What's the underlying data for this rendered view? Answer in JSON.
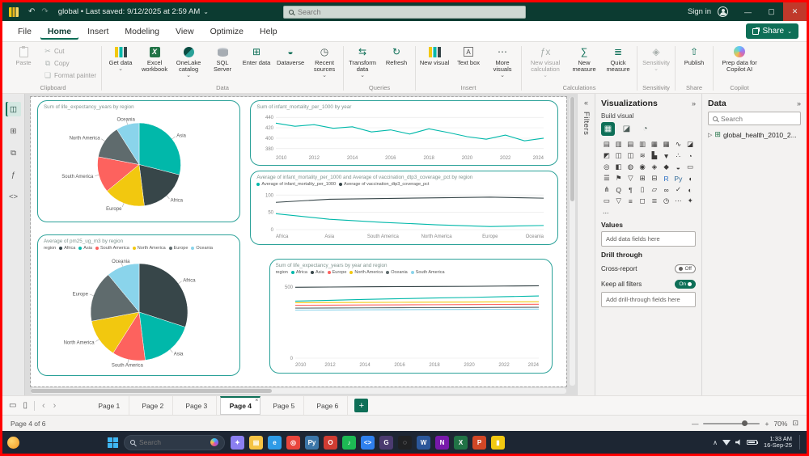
{
  "colors": {
    "titlebar_bg": "#0C3B31",
    "accent_green": "#0E6F57",
    "visual_border": "#2AA198",
    "palette": [
      "#01B8AA",
      "#374649",
      "#FD625E",
      "#F2C80F",
      "#5F6B6D",
      "#8AD4EB"
    ],
    "taskbar_bg": "#1D2633",
    "frame_border": "#FF0000"
  },
  "glyphs": {
    "caret": "⌄",
    "undo": "↶",
    "redo": "↷",
    "minimize": "—",
    "maximize": "▢",
    "close": "✕",
    "chev_left": "«",
    "chev_right": "»",
    "expander": "▷",
    "close_tab": "×",
    "plus": "+",
    "minus": "—",
    "fit": "⊡",
    "arrow_left": "‹",
    "arrow_right": "›",
    "monitor": "▭",
    "phone": "▯",
    "cut": "✂",
    "copy": "⧉",
    "format_painter": "❏",
    "excel_x": "X",
    "enter_data": "⊞",
    "dataverse": "◒",
    "recent": "◷",
    "transform": "⇆",
    "refresh": "↻",
    "text_box": "A",
    "more_dots": "⋯",
    "fx": "ƒx",
    "sum": "∑",
    "quick": "≣",
    "sensitivity": "◈",
    "publish": "⇧",
    "build_tab": "▦",
    "format_tab": "◪",
    "analytics_tab": "◔",
    "table_green": "⊞",
    "tray_chevron": "∧"
  },
  "titlebar": {
    "title_full": "global  •  Last saved: 9/12/2025 at 2:59 AM",
    "search_placeholder": "Search",
    "sign_in": "Sign in"
  },
  "menubar": {
    "items": [
      "File",
      "Home",
      "Insert",
      "Modeling",
      "View",
      "Optimize",
      "Help"
    ],
    "share": "Share"
  },
  "ribbon": {
    "clipboard": {
      "label": "Clipboard",
      "paste": "Paste",
      "cut": "Cut",
      "copy": "Copy",
      "format_painter": "Format painter"
    },
    "data_group": {
      "label": "Data",
      "get_data": "Get data",
      "excel": "Excel workbook",
      "onelake": "OneLake catalog",
      "sql": "SQL Server",
      "enter": "Enter data",
      "dataverse": "Dataverse",
      "recent": "Recent sources"
    },
    "queries": {
      "label": "Queries",
      "transform": "Transform data",
      "refresh": "Refresh"
    },
    "insert": {
      "label": "Insert",
      "new_visual": "New visual",
      "text_box": "Text box",
      "more_visuals": "More visuals"
    },
    "calculations": {
      "label": "Calculations",
      "new_calc": "New visual calculation",
      "new_measure": "New measure",
      "quick_measure": "Quick measure"
    },
    "sensitivity": {
      "label": "Sensitivity",
      "button": "Sensitivity"
    },
    "share_group": {
      "label": "Share",
      "publish": "Publish"
    },
    "copilot": {
      "label": "Copilot",
      "prep": "Prep data for Copilot AI"
    }
  },
  "view_rail": [
    {
      "name": "report-view",
      "glyph": "◫",
      "selected": true
    },
    {
      "name": "table-view",
      "glyph": "⊞"
    },
    {
      "name": "model-view",
      "glyph": "⧉"
    },
    {
      "name": "dax-query-view",
      "glyph": "ƒ"
    },
    {
      "name": "tmdl-view",
      "glyph": "<>"
    }
  ],
  "filters_panel": {
    "header": "Filters"
  },
  "viz_panel": {
    "header": "Visualizations",
    "build_label": "Build visual",
    "more": "...",
    "values_label": "Values",
    "add_fields": "Add data fields here",
    "drill_label": "Drill through",
    "cross_report": "Cross-report",
    "toggle_off": "Off",
    "keep_filters": "Keep all filters",
    "toggle_on": "On",
    "add_drill": "Add drill-through fields here",
    "gallery": [
      {
        "n": "stacked-bar-chart",
        "g": "▤"
      },
      {
        "n": "stacked-column-chart",
        "g": "▥"
      },
      {
        "n": "clustered-bar-chart",
        "g": "▤"
      },
      {
        "n": "clustered-column-chart",
        "g": "▥"
      },
      {
        "n": "100-stacked-bar-chart",
        "g": "▦"
      },
      {
        "n": "100-stacked-column-chart",
        "g": "▦"
      },
      {
        "n": "line-chart",
        "g": "∿"
      },
      {
        "n": "area-chart",
        "g": "◪"
      },
      {
        "n": "stacked-area-chart",
        "g": "◩"
      },
      {
        "n": "line-and-stacked-column-chart",
        "g": "◫"
      },
      {
        "n": "line-and-clustered-column-chart",
        "g": "◫"
      },
      {
        "n": "ribbon-chart",
        "g": "≋"
      },
      {
        "n": "waterfall-chart",
        "g": "▙"
      },
      {
        "n": "funnel-chart",
        "g": "▼"
      },
      {
        "n": "scatter-chart",
        "g": "∴"
      },
      {
        "n": "pie-chart",
        "g": "◔"
      },
      {
        "n": "donut-chart",
        "g": "◎"
      },
      {
        "n": "treemap",
        "g": "◧"
      },
      {
        "n": "map",
        "g": "◍"
      },
      {
        "n": "filled-map",
        "g": "◉"
      },
      {
        "n": "shape-map",
        "g": "◈"
      },
      {
        "n": "azure-map",
        "g": "◆"
      },
      {
        "n": "gauge",
        "g": "◒"
      },
      {
        "n": "card",
        "g": "▭"
      },
      {
        "n": "multi-row-card",
        "g": "☰"
      },
      {
        "n": "kpi",
        "g": "⚑"
      },
      {
        "n": "slicer",
        "g": "▽"
      },
      {
        "n": "table",
        "g": "⊞"
      },
      {
        "n": "matrix",
        "g": "⊟"
      },
      {
        "n": "r-script-visual",
        "g": "R",
        "c": "#276dc3"
      },
      {
        "n": "python-visual",
        "g": "Py",
        "c": "#306998"
      },
      {
        "n": "key-influencers",
        "g": "◖"
      },
      {
        "n": "decomposition-tree",
        "g": "⋔"
      },
      {
        "n": "q-and-a",
        "g": "Q"
      },
      {
        "n": "smart-narrative",
        "g": "¶"
      },
      {
        "n": "paginated-report",
        "g": "▯"
      },
      {
        "n": "power-apps",
        "g": "▱"
      },
      {
        "n": "power-automate",
        "g": "∞"
      },
      {
        "n": "metrics",
        "g": "✓"
      },
      {
        "n": "arcgis-map",
        "g": "◐"
      },
      {
        "n": "new-card",
        "g": "▭"
      },
      {
        "n": "new-slicer",
        "g": "▽"
      },
      {
        "n": "text-slicer",
        "g": "≡"
      },
      {
        "n": "button-slicer",
        "g": "◻"
      },
      {
        "n": "list-slicer",
        "g": "≣"
      },
      {
        "n": "date-slicer",
        "g": "◷"
      },
      {
        "n": "get-more-visuals",
        "g": "⋯"
      },
      {
        "n": "custom-visual",
        "g": "✦"
      }
    ]
  },
  "data_panel": {
    "header": "Data",
    "search_placeholder": "Search",
    "table": "global_health_2010_2..."
  },
  "pages": {
    "items": [
      "Page 1",
      "Page 2",
      "Page 3",
      "Page 4",
      "Page 5",
      "Page 6"
    ],
    "active": "Page 4"
  },
  "status": {
    "page_info": "Page 4 of 6",
    "zoom": "70%"
  },
  "taskbar": {
    "search_placeholder": "Search",
    "time": "1:33 AM",
    "date": "16-Sep-25",
    "apps": [
      {
        "name": "copilot",
        "color": "#8b7ff0",
        "glyph": "✦"
      },
      {
        "name": "file-explorer",
        "color": "#f5c344",
        "glyph": "▤"
      },
      {
        "name": "microsoft-edge",
        "color": "#2e9be6",
        "glyph": "e"
      },
      {
        "name": "chrome",
        "color": "#e8453c",
        "glyph": "◎"
      },
      {
        "name": "python",
        "color": "#3c76a8",
        "glyph": "Py"
      },
      {
        "name": "opera",
        "color": "#cf3c32",
        "glyph": "O"
      },
      {
        "name": "spotify",
        "color": "#1db954",
        "glyph": "♪"
      },
      {
        "name": "vs-code",
        "color": "#2f80ed",
        "glyph": "<>"
      },
      {
        "name": "github-desktop",
        "color": "#4b3b70",
        "glyph": "G"
      },
      {
        "name": "chatgpt",
        "color": "#202123",
        "glyph": "◌"
      },
      {
        "name": "word",
        "color": "#2b579a",
        "glyph": "W"
      },
      {
        "name": "onenote",
        "color": "#7719aa",
        "glyph": "N"
      },
      {
        "name": "excel",
        "color": "#217346",
        "glyph": "X"
      },
      {
        "name": "powerpoint",
        "color": "#d24726",
        "glyph": "P"
      },
      {
        "name": "power-bi",
        "color": "#f2c811",
        "glyph": "▮"
      }
    ]
  },
  "chart_data": [
    {
      "type": "pie",
      "title": "Sum of life_expectancy_years by region",
      "labels": [
        "Asia",
        "Africa",
        "Europe",
        "South America",
        "North America",
        "Oceania"
      ],
      "values": [
        29,
        19,
        16,
        14,
        13,
        9
      ],
      "colors": [
        "#01B8AA",
        "#374649",
        "#F2C80F",
        "#FD625E",
        "#5F6B6D",
        "#8AD4EB"
      ]
    },
    {
      "type": "line",
      "title": "Sum of infant_mortality_per_1000 by year",
      "x_labels": [
        "2010",
        "2012",
        "2014",
        "2016",
        "2018",
        "2020",
        "2022",
        "2024"
      ],
      "y_ticks": [
        380,
        400,
        420,
        440
      ],
      "y_min": 375,
      "y_max": 445,
      "series": [
        {
          "name": "Sum of infant_mortality_per_1000",
          "color": "#01B8AA",
          "values": [
            429,
            423,
            426,
            419,
            422,
            412,
            416,
            408,
            418,
            411,
            403,
            398,
            406,
            395,
            400
          ]
        }
      ]
    },
    {
      "type": "line",
      "title": "Average of infant_mortality_per_1000 and Average of vaccination_dtp3_coverage_pct by region",
      "legend": true,
      "x_labels": [
        "Africa",
        "Asia",
        "South America",
        "North America",
        "Europe",
        "Oceania"
      ],
      "y_ticks": [
        0,
        50,
        100
      ],
      "y_min": 0,
      "y_max": 110,
      "series": [
        {
          "name": "Average of infant_mortality_per_1000",
          "color": "#01B8AA",
          "values": [
            46,
            30,
            21,
            14,
            9,
            12
          ]
        },
        {
          "name": "Average of vaccination_dtp3_coverage_pct",
          "color": "#374649",
          "values": [
            79,
            88,
            90,
            92,
            94,
            91
          ]
        }
      ]
    },
    {
      "type": "pie",
      "title": "Average of pm25_ug_m3 by region",
      "legend": true,
      "legend_title": "region",
      "labels": [
        "Africa",
        "Asia",
        "South America",
        "North America",
        "Europe",
        "Oceania"
      ],
      "values": [
        30,
        18,
        11,
        13,
        17,
        11
      ],
      "colors": [
        "#374649",
        "#01B8AA",
        "#FD625E",
        "#F2C80F",
        "#5F6B6D",
        "#8AD4EB"
      ]
    },
    {
      "type": "line",
      "title": "Sum of life_expectancy_years by year and region",
      "legend": true,
      "legend_title": "region",
      "x_labels": [
        "2010",
        "2012",
        "2014",
        "2016",
        "2018",
        "2020",
        "2022",
        "2024"
      ],
      "y_ticks": [
        0,
        500
      ],
      "y_min": 0,
      "y_max": 550,
      "series": [
        {
          "name": "Africa",
          "color": "#01B8AA",
          "values": [
            400,
            406,
            412,
            417,
            422,
            426,
            431,
            436
          ]
        },
        {
          "name": "Asia",
          "color": "#374649",
          "values": [
            497,
            499,
            501,
            502,
            503,
            504,
            506,
            508
          ]
        },
        {
          "name": "Europe",
          "color": "#FD625E",
          "values": [
            371,
            372,
            373,
            374,
            375,
            376,
            377,
            378
          ]
        },
        {
          "name": "North America",
          "color": "#F2C80F",
          "values": [
            389,
            390,
            391,
            392,
            393,
            394,
            395,
            396
          ]
        },
        {
          "name": "Oceania",
          "color": "#5F6B6D",
          "values": [
            351,
            352,
            353,
            354,
            355,
            355,
            356,
            357
          ]
        },
        {
          "name": "South America",
          "color": "#8AD4EB",
          "values": [
            337,
            338,
            339,
            340,
            341,
            342,
            343,
            344
          ]
        }
      ]
    }
  ]
}
